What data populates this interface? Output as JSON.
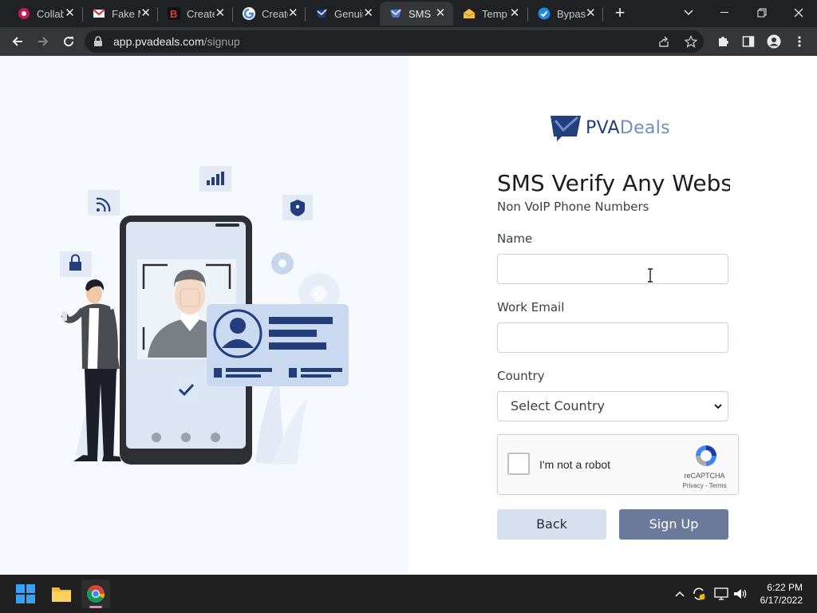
{
  "browser": {
    "tabs": [
      {
        "title": "Collab",
        "favicon": "collab-icon",
        "active": false
      },
      {
        "title": "Fake Mail",
        "favicon": "mail-envelope-icon",
        "active": false
      },
      {
        "title": "Create",
        "favicon": "b-logo-icon",
        "active": false
      },
      {
        "title": "Create",
        "favicon": "google-g-icon",
        "active": false
      },
      {
        "title": "Genuine",
        "favicon": "pvadeals-icon",
        "active": false
      },
      {
        "title": "SMS",
        "favicon": "pvadeals-icon",
        "active": true
      },
      {
        "title": "Temp",
        "favicon": "envelope-open-icon",
        "active": false
      },
      {
        "title": "Bypass",
        "favicon": "check-shield-icon",
        "active": false
      }
    ],
    "close_glyph": "✕",
    "new_tab_glyph": "+",
    "url_host": "app.pvadeals.com",
    "url_path": "/signup"
  },
  "page": {
    "brand_part1": "PVA",
    "brand_part2": "Deals",
    "brand_color_dark": "#233e7d",
    "brand_color_light": "#6e8fc4",
    "heading": "SMS Verify Any Website",
    "subheading": "Non VoIP Phone Numbers",
    "form": {
      "name_label": "Name",
      "name_value": "",
      "email_label": "Work Email",
      "email_value": "",
      "country_label": "Country",
      "country_selected": "Select Country"
    },
    "captcha": {
      "label": "I'm not a robot",
      "brand": "reCAPTCHA",
      "terms": "Privacy - Terms"
    },
    "back_label": "Back",
    "signup_label": "Sign Up"
  },
  "taskbar": {
    "time": "6:22 PM",
    "date": "6/17/2022",
    "pinned": [
      "windows-start-icon",
      "file-explorer-icon",
      "chrome-icon"
    ]
  }
}
